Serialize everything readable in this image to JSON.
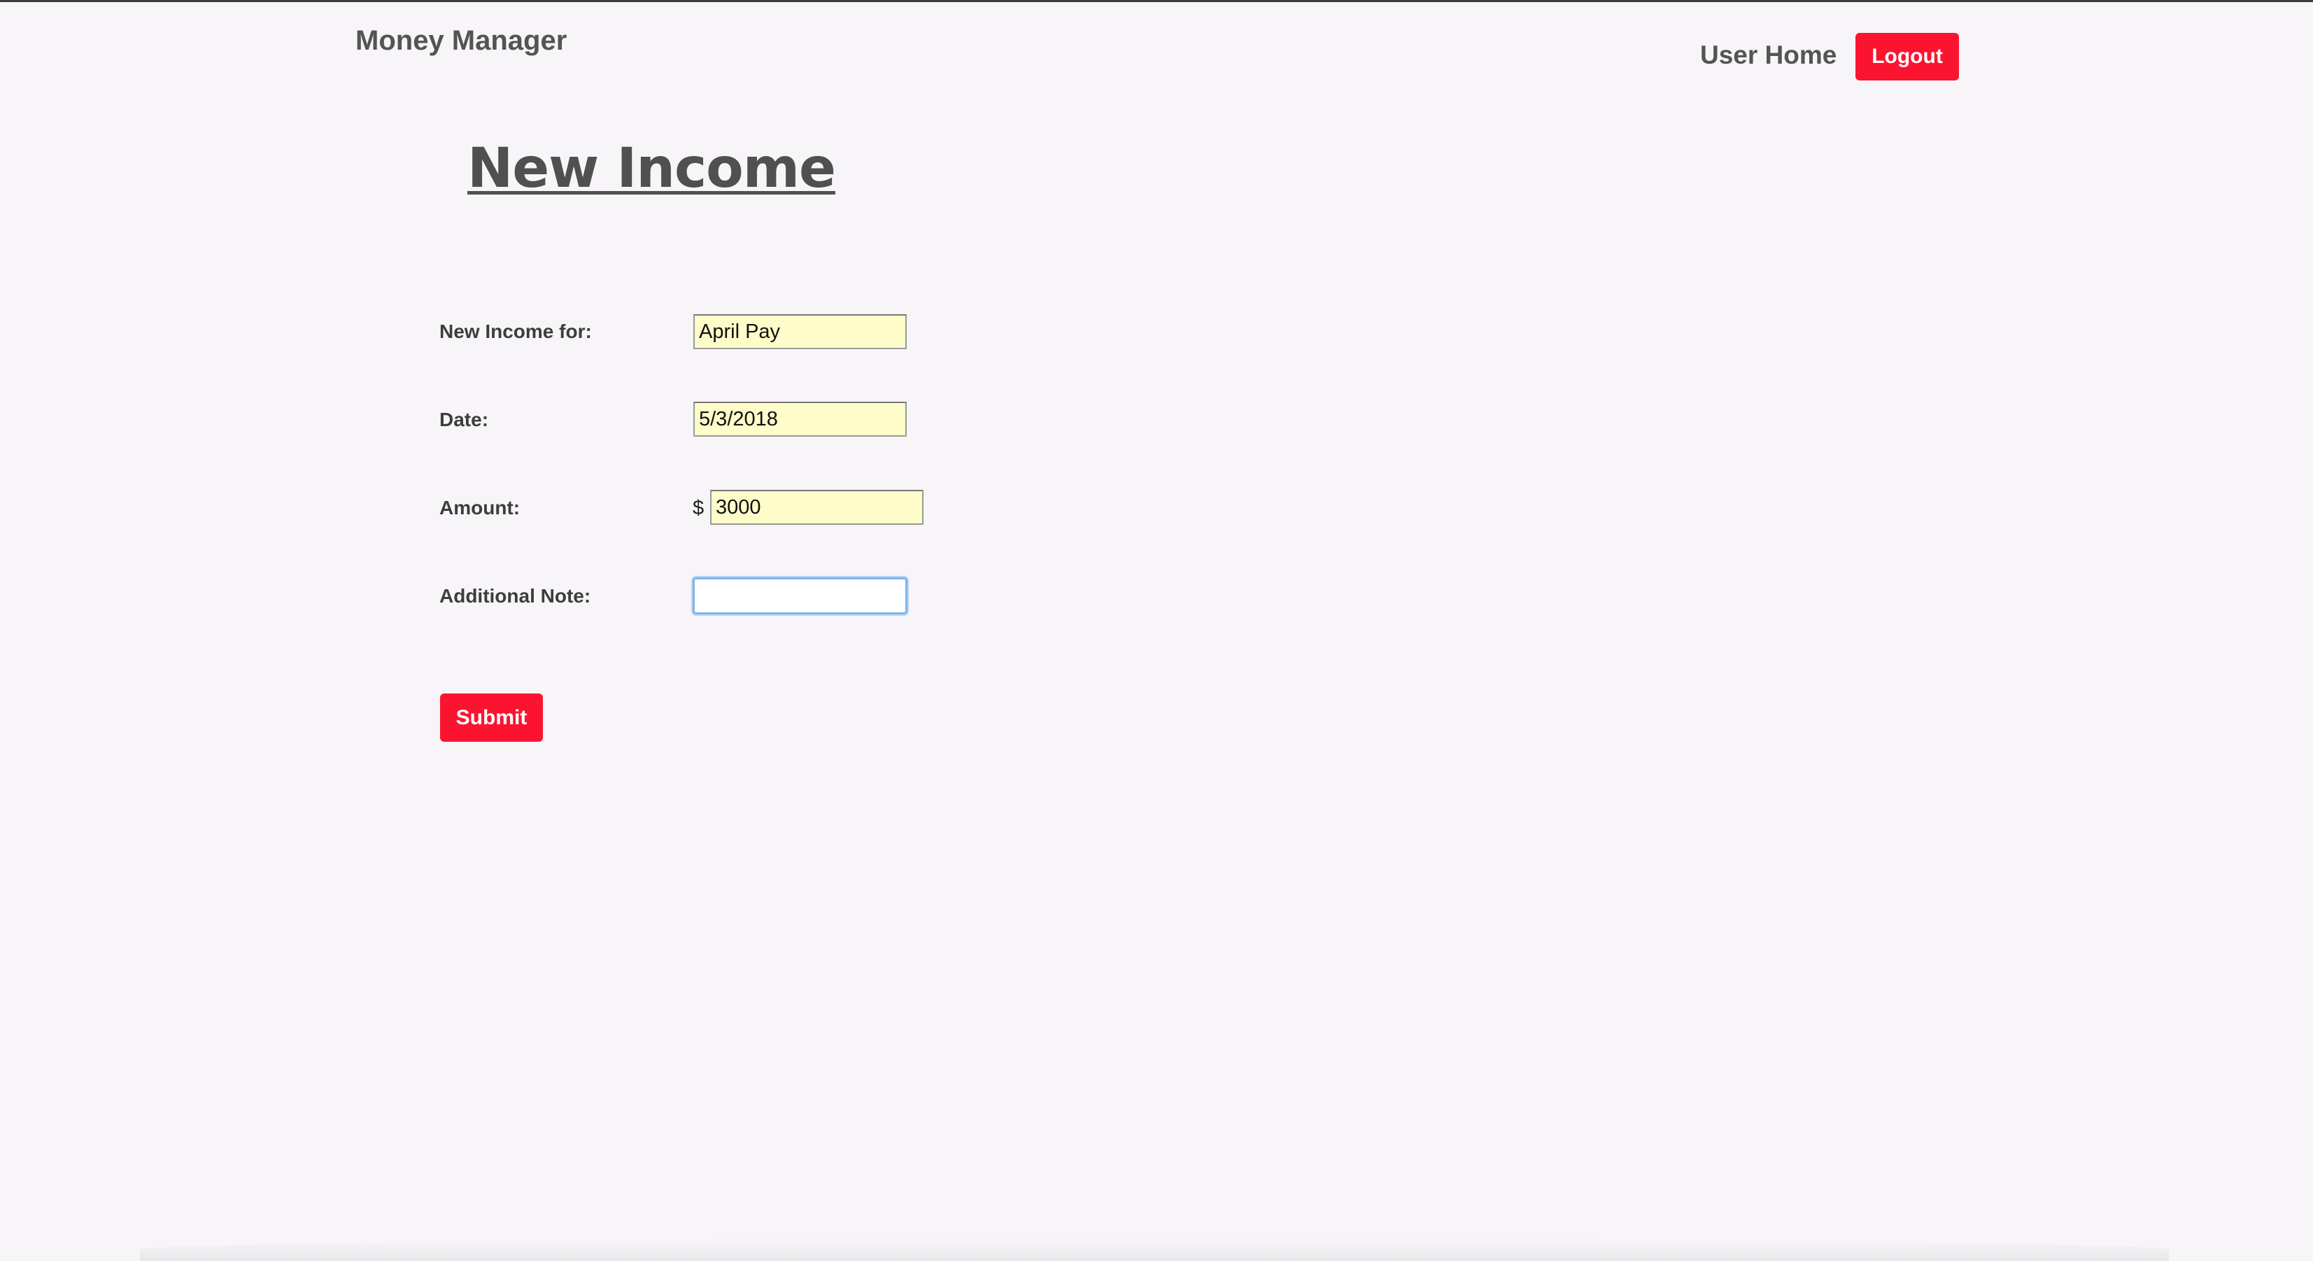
{
  "header": {
    "brand": "Money Manager",
    "nav_home": "User Home",
    "logout_label": "Logout"
  },
  "page": {
    "title": "New Income"
  },
  "form": {
    "income_for": {
      "label": "New Income for:",
      "value": "April Pay"
    },
    "date": {
      "label": "Date:",
      "value": "5/3/2018"
    },
    "amount": {
      "label": "Amount:",
      "currency_symbol": "$",
      "value": "3000"
    },
    "note": {
      "label": "Additional Note:",
      "value": ""
    },
    "submit_label": "Submit"
  },
  "colors": {
    "accent": "#fb1430",
    "input_fill": "#fefcc8",
    "focus_ring": "#7fb3ea",
    "text": "#545454"
  }
}
